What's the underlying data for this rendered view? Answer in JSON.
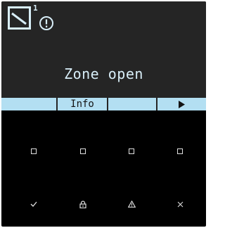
{
  "display": {
    "zone_number": "1",
    "message": "Zone open"
  },
  "softkeys": [
    {
      "label": ""
    },
    {
      "label": "Info"
    },
    {
      "label": ""
    },
    {
      "label": "",
      "icon": "play-arrow-icon"
    }
  ],
  "keypad": {
    "function_keys": [
      "square-icon",
      "square-icon",
      "square-icon",
      "square-icon"
    ],
    "action_keys": [
      "checkmark-icon",
      "lock-icon",
      "warning-icon",
      "close-icon"
    ]
  },
  "colors": {
    "lcd_background": "#252525",
    "lcd_text": "#d8eef8",
    "softkey_background": "#b3dff2",
    "keypad_background": "#000000",
    "key_symbol": "#e0e0e0"
  }
}
